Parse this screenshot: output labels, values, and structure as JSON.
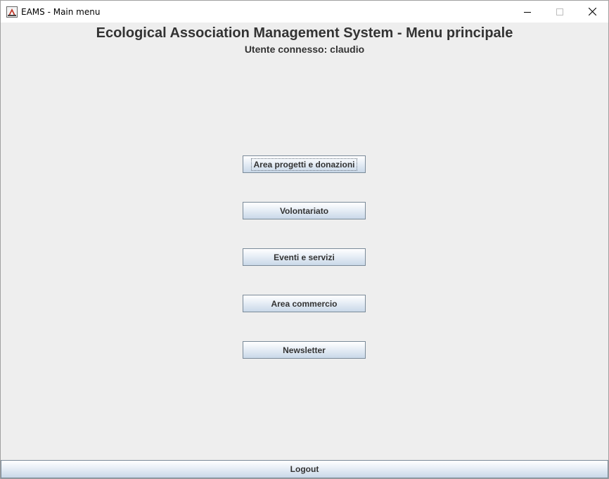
{
  "window": {
    "title": "EAMS - Main menu",
    "icon": "java-app-icon",
    "controls": [
      "minimize-icon",
      "maximize-icon",
      "close-icon"
    ]
  },
  "header": {
    "title": "Ecological Association Management System - Menu principale",
    "subtitle": "Utente connesso: claudio"
  },
  "menu": {
    "items": [
      {
        "label": "Area progetti e donazioni",
        "focused": true
      },
      {
        "label": "Volontariato"
      },
      {
        "label": "Eventi e servizi"
      },
      {
        "label": "Area commercio"
      },
      {
        "label": "Newsletter"
      }
    ]
  },
  "footer": {
    "logout_label": "Logout"
  },
  "colors": {
    "background": "#eeeeee",
    "text": "#333333",
    "button_border": "#7a8a99"
  }
}
